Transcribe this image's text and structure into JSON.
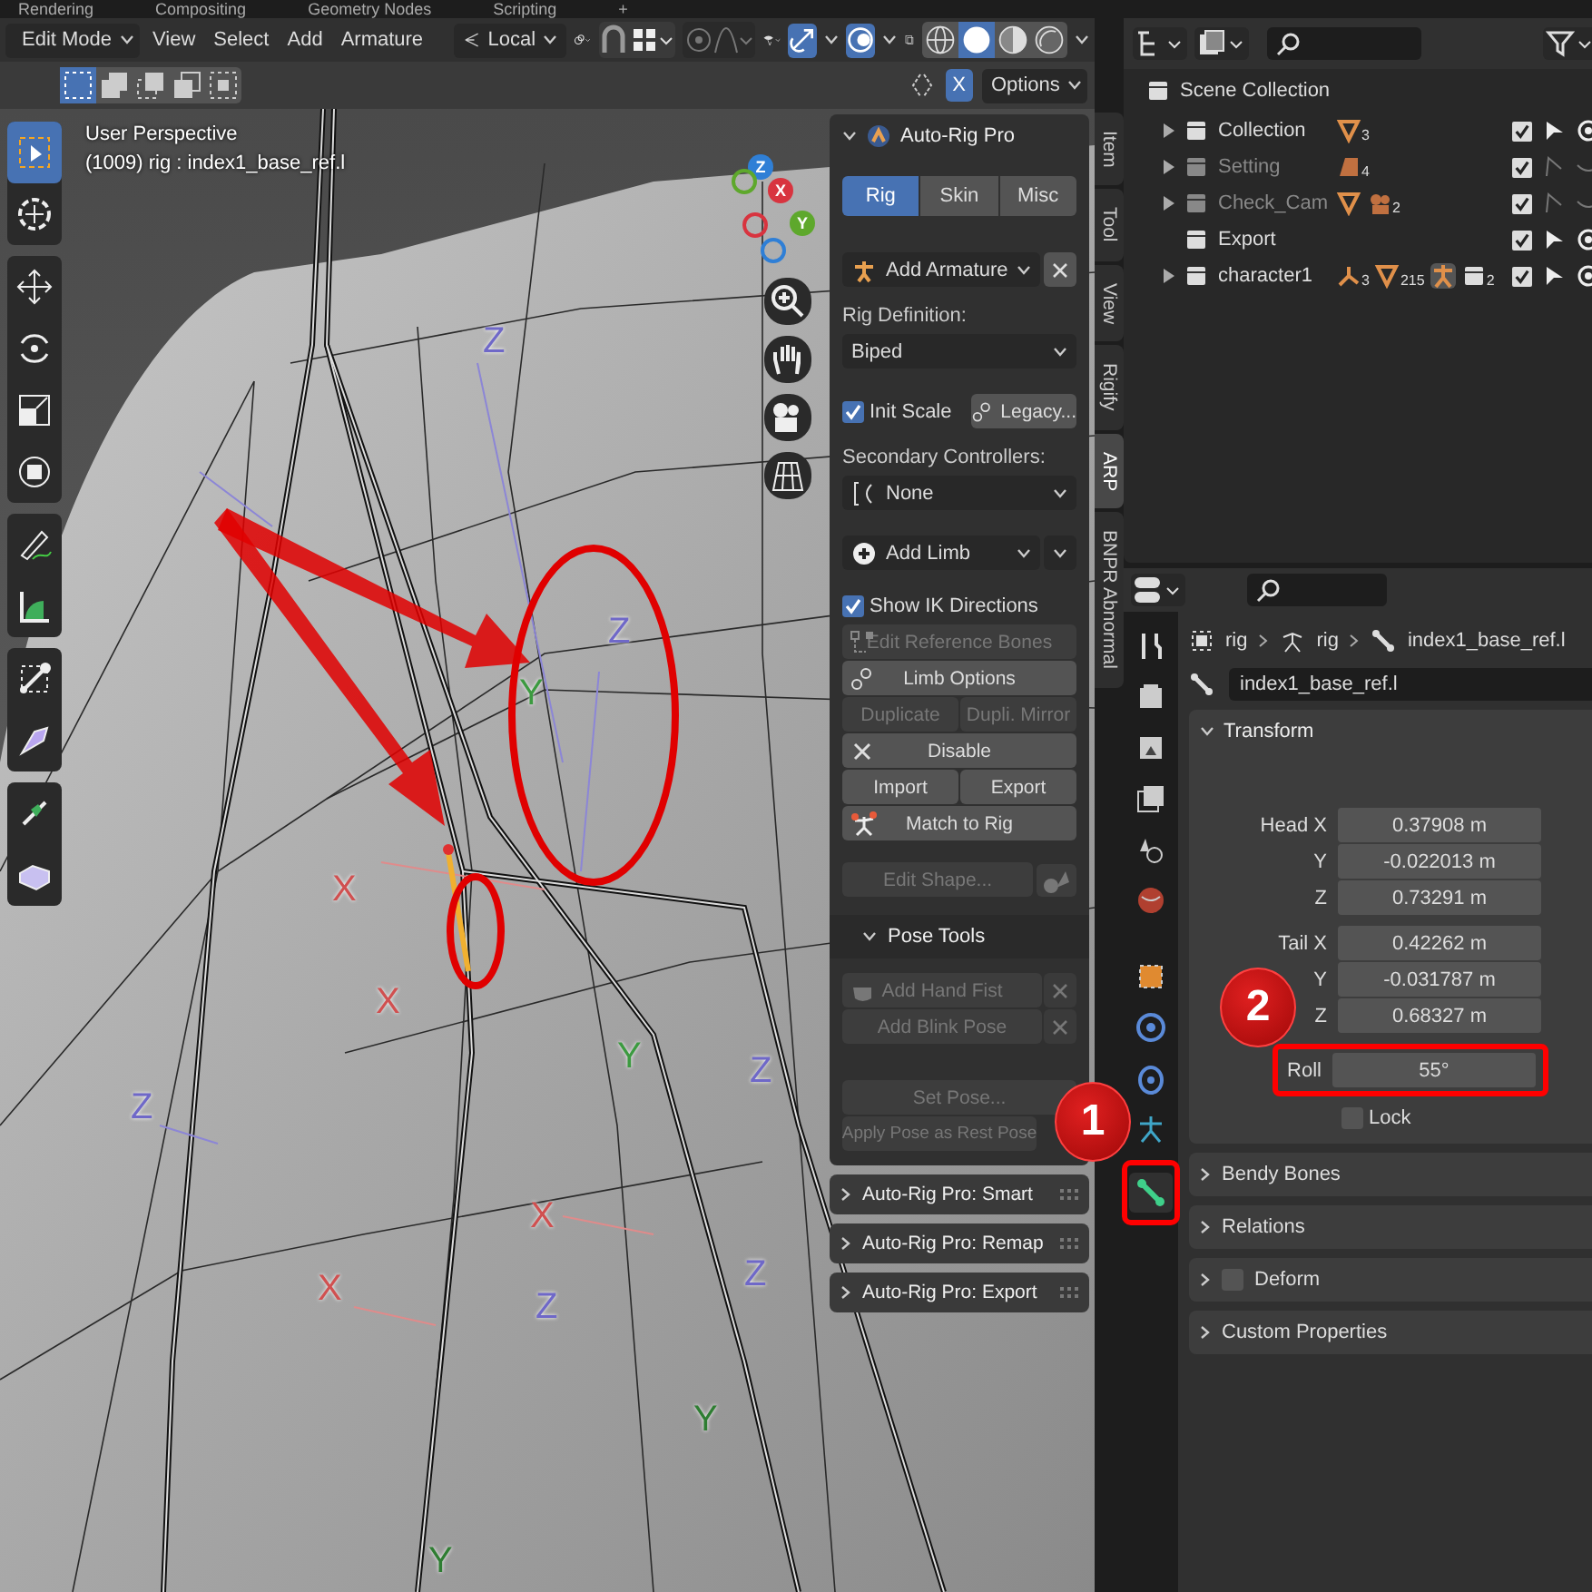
{
  "workspace_tabs": [
    "Rendering",
    "Compositing",
    "Geometry Nodes",
    "Scripting",
    "+"
  ],
  "header": {
    "snapping_on": false,
    "proportional_on": false,
    "mode": "Edit Mode",
    "menus": [
      "View",
      "Select",
      "Add",
      "Armature"
    ],
    "orientation": "Local",
    "x_toggle": "X",
    "options": "Options"
  },
  "viewport": {
    "view_name": "User Perspective",
    "object_info": "(1009) rig : index1_base_ref.l",
    "gizmo_labels": [
      "Z",
      "X",
      "Y"
    ],
    "tool_groups": [
      [
        {
          "kind": "select",
          "selected": true
        },
        {
          "kind": "cursor",
          "selected": false
        }
      ],
      [
        {
          "kind": "move",
          "selected": false
        },
        {
          "kind": "rotate",
          "selected": false
        },
        {
          "kind": "scale",
          "selected": false
        },
        {
          "kind": "transform",
          "selected": false
        }
      ],
      [
        {
          "kind": "annotate",
          "selected": false
        },
        {
          "kind": "measure",
          "selected": false
        }
      ],
      [
        {
          "kind": "roll",
          "selected": false
        },
        {
          "kind": "bone-size",
          "selected": false
        }
      ],
      [
        {
          "kind": "extrude",
          "selected": false
        },
        {
          "kind": "box",
          "selected": false
        }
      ]
    ],
    "axis_labels": [
      {
        "text": "Z",
        "color": "#6f68c8"
      },
      {
        "text": "Z",
        "color": "#6f68c8"
      },
      {
        "text": "Y",
        "color": "#3c9a40"
      },
      {
        "text": "X",
        "color": "#d05050"
      },
      {
        "text": "Z",
        "color": "#6f68c8"
      },
      {
        "text": "Y",
        "color": "#3c9a40"
      },
      {
        "text": "Z",
        "color": "#6f68c8"
      },
      {
        "text": "X",
        "color": "#d05050"
      },
      {
        "text": "X",
        "color": "#d05050"
      },
      {
        "text": "Z",
        "color": "#6f68c8"
      },
      {
        "text": "Y",
        "color": "#2e7d32"
      },
      {
        "text": "Y",
        "color": "#2e7d32"
      },
      {
        "text": "Z",
        "color": "#6f68c8"
      },
      {
        "text": "X",
        "color": "#d05050"
      }
    ]
  },
  "n_panel": {
    "title": "Auto-Rig Pro",
    "tabs": [
      {
        "label": "Rig",
        "selected": true
      },
      {
        "label": "Skin",
        "selected": false
      },
      {
        "label": "Misc",
        "selected": false
      }
    ],
    "add_armature": "Add Armature",
    "rig_definition_label": "Rig Definition:",
    "rig_definition": "Biped",
    "init_scale": {
      "label": "Init Scale",
      "checked": true
    },
    "legacy": "Legacy...",
    "secondary_label": "Secondary Controllers:",
    "secondary": "None",
    "add_limb": "Add Limb",
    "show_ik": {
      "label": "Show IK Directions",
      "checked": true
    },
    "action_rows": [
      [
        {
          "label": "Edit Reference Bones",
          "kind": "bones",
          "disabled": true
        }
      ],
      [
        {
          "label": "Limb Options",
          "kind": "gear",
          "disabled": false
        }
      ],
      [
        {
          "label": "Duplicate",
          "kind": "plain",
          "disabled": true
        },
        {
          "label": "Dupli. Mirror",
          "kind": "plain",
          "disabled": true
        }
      ],
      [
        {
          "label": "Disable",
          "kind": "x",
          "disabled": false
        }
      ],
      [
        {
          "label": "Import",
          "kind": "plain",
          "disabled": false
        },
        {
          "label": "Export",
          "kind": "plain",
          "disabled": false
        }
      ],
      [
        {
          "label": "Match to Rig",
          "kind": "figure",
          "disabled": false
        }
      ]
    ],
    "edit_shape": {
      "label": "Edit Shape...",
      "disabled": true
    },
    "pose_tools": {
      "title": "Pose Tools",
      "expanded": true,
      "items": [
        {
          "label": "Add Hand Fist",
          "kind": "fist",
          "disabled": true
        },
        {
          "label": "Add Blink Pose",
          "kind": "plain",
          "disabled": true
        }
      ],
      "set_pose": {
        "label": "Set Pose...",
        "disabled": true
      },
      "apply_pose": {
        "label": "Apply Pose as Rest Pose",
        "disabled": true
      }
    },
    "collapsed_panels": [
      "Auto-Rig Pro: Smart",
      "Auto-Rig Pro: Remap",
      "Auto-Rig Pro: Export"
    ]
  },
  "side_tabs": [
    {
      "label": "Item",
      "selected": false
    },
    {
      "label": "Tool",
      "selected": false
    },
    {
      "label": "View",
      "selected": false
    },
    {
      "label": "Rigify",
      "selected": false
    },
    {
      "label": "ARP",
      "selected": true
    },
    {
      "label": "BNPR Abnormal",
      "selected": false
    }
  ],
  "outliner": {
    "root": "Scene Collection",
    "items": [
      {
        "name": "Collection",
        "checked": true,
        "expandable": true,
        "disabled": false,
        "badges": [
          {
            "kind": "mesh",
            "count": "3"
          }
        ]
      },
      {
        "name": "Setting",
        "checked": true,
        "expandable": true,
        "disabled": true,
        "badges": [
          {
            "kind": "image",
            "count": "4"
          }
        ]
      },
      {
        "name": "Check_Cam",
        "checked": true,
        "expandable": true,
        "disabled": true,
        "badges": [
          {
            "kind": "mesh"
          },
          {
            "kind": "camera",
            "count": "2"
          }
        ]
      },
      {
        "name": "Export",
        "checked": true,
        "expandable": false,
        "disabled": false
      },
      {
        "name": "character1",
        "checked": true,
        "expandable": true,
        "disabled": false,
        "badges": [
          {
            "kind": "armature",
            "count": "3"
          },
          {
            "kind": "mesh",
            "count": "215"
          },
          {
            "kind": "figure"
          },
          {
            "kind": "collection",
            "count": "2"
          }
        ]
      }
    ]
  },
  "properties": {
    "breadcrumb": [
      "rig",
      "rig",
      "index1_base_ref.l"
    ],
    "bone_name": "index1_base_ref.l",
    "tabs": [
      {
        "kind": "tool",
        "selected": false
      },
      {
        "kind": "render",
        "selected": false
      },
      {
        "kind": "output",
        "selected": false
      },
      {
        "kind": "view-layer",
        "selected": false
      },
      {
        "kind": "scene",
        "selected": false
      },
      {
        "kind": "world",
        "selected": false
      },
      {
        "kind": "object",
        "selected": false
      },
      {
        "kind": "modifier",
        "selected": false
      },
      {
        "kind": "physics",
        "selected": false
      },
      {
        "kind": "armature",
        "selected": false
      },
      {
        "kind": "bone",
        "selected": true
      }
    ],
    "transform": {
      "title": "Transform",
      "expanded": true,
      "groups": [
        [
          {
            "label": "Head X",
            "value": "0.37908 m"
          },
          {
            "label": "Y",
            "value": "-0.022013 m"
          },
          {
            "label": "Z",
            "value": "0.73291 m"
          }
        ],
        [
          {
            "label": "Tail X",
            "value": "0.42262 m"
          },
          {
            "label": "Y",
            "value": "-0.031787 m"
          },
          {
            "label": "Z",
            "value": "0.68327 m"
          }
        ],
        [
          {
            "label": "Roll",
            "value": "55°"
          }
        ]
      ],
      "lock": {
        "label": "Lock",
        "checked": false
      }
    },
    "panels": [
      {
        "title": "Bendy Bones",
        "kind": "plain"
      },
      {
        "title": "Relations",
        "kind": "plain"
      },
      {
        "title": "Deform",
        "kind": "checkbox",
        "checked": false
      },
      {
        "title": "Custom Properties",
        "kind": "plain"
      }
    ]
  },
  "callouts": [
    "1",
    "2"
  ]
}
